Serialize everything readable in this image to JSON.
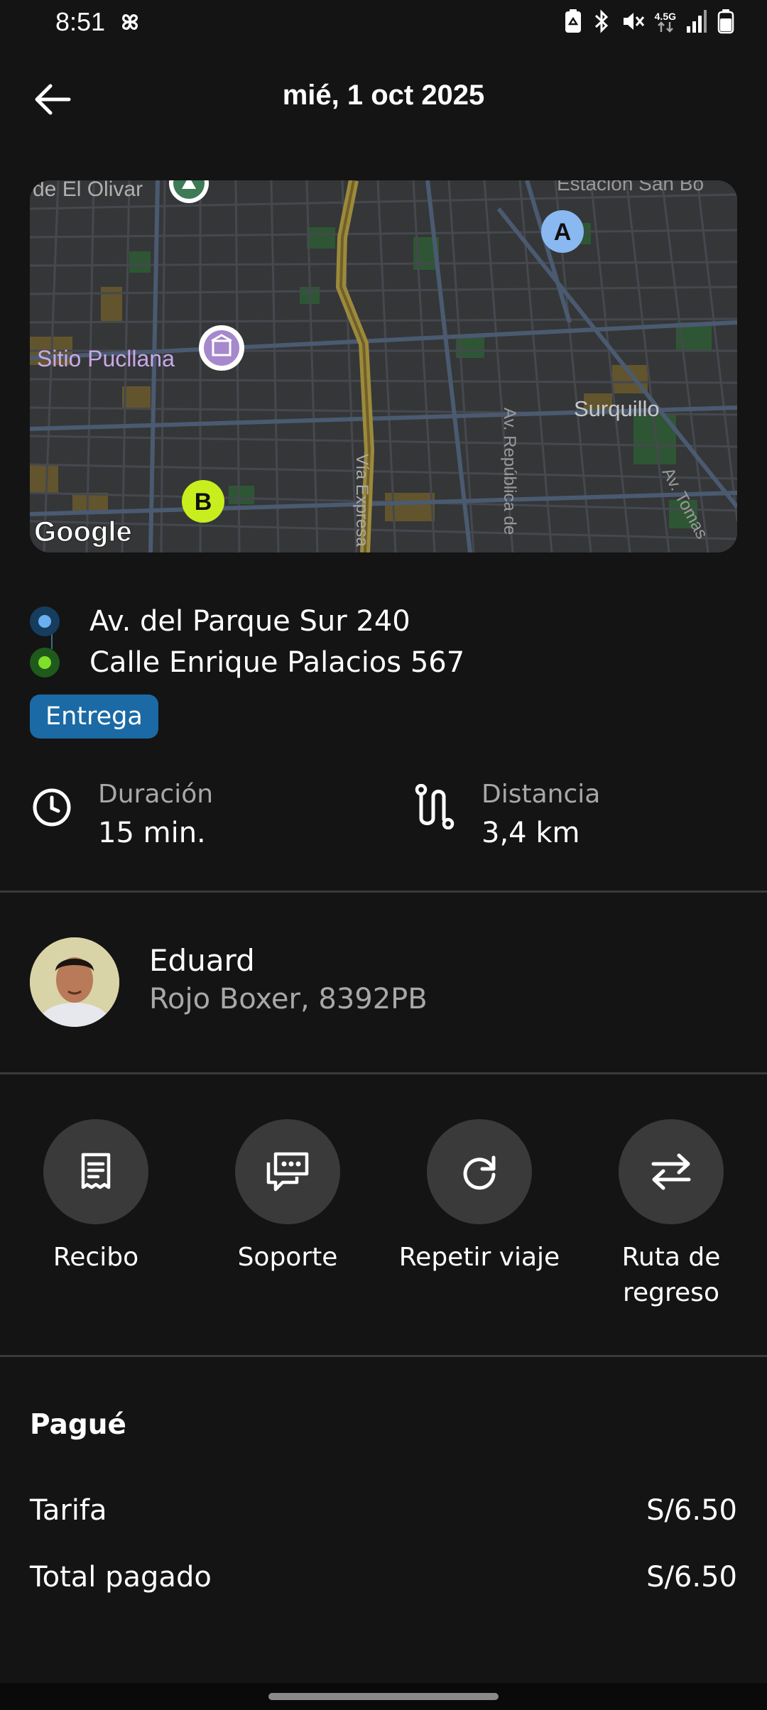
{
  "status_bar": {
    "time": "8:51",
    "network_type": "4.5G"
  },
  "header": {
    "title": "mié, 1 oct 2025"
  },
  "map": {
    "labels": {
      "top_left": "de El Olivar",
      "top_right": "Estación San Bo",
      "sitio": "Sitio Pucllana",
      "surquillo": "Surquillo",
      "via_expresa": "Vía Expresa",
      "av_republica": "Av. República de",
      "av_tomas": "Av. Tomas"
    },
    "marker_a": "A",
    "marker_b": "B",
    "attribution": "Google",
    "colors": {
      "background": "#353638",
      "road": "#4a5a70",
      "highway": "#9c8a3c",
      "park": "#2e5a34",
      "marker_a": "#8ab8f0",
      "marker_b": "#c8ee1e"
    }
  },
  "route": {
    "origin": "Av. del Parque Sur 240",
    "destination": "Calle Enrique Palacios 567",
    "origin_color": "#6ab0f0",
    "destination_color": "#7ee02a"
  },
  "tag": "Entrega",
  "stats": {
    "duration_label": "Duración",
    "duration_value": "15 min.",
    "distance_label": "Distancia",
    "distance_value": "3,4 km"
  },
  "driver": {
    "name": "Eduard",
    "vehicle": "Rojo  Boxer, 8392PB"
  },
  "actions": [
    {
      "label": "Recibo",
      "icon": "receipt-icon"
    },
    {
      "label": "Soporte",
      "icon": "support-chat-icon"
    },
    {
      "label": "Repetir viaje",
      "icon": "repeat-icon"
    },
    {
      "label": "Ruta de regreso",
      "icon": "swap-arrows-icon"
    }
  ],
  "payment": {
    "title": "Pagué",
    "rows": [
      {
        "label": "Tarifa",
        "value": "S/6.50"
      },
      {
        "label": "Total pagado",
        "value": "S/6.50"
      }
    ]
  }
}
